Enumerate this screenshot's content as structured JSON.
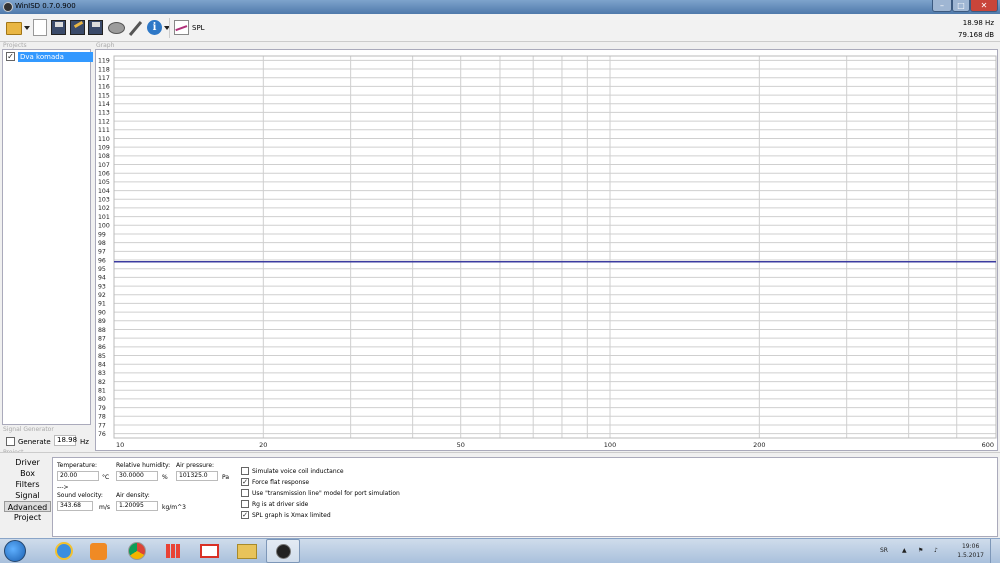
{
  "window": {
    "title": "WinISD 0.7.0.900",
    "minimize_label": "–",
    "maximize_label": "□",
    "close_label": "✕"
  },
  "toolbar": {
    "icons": [
      "open-folder-icon",
      "new-document-icon",
      "save-icon",
      "save-as-icon",
      "save-all-icon",
      "driver-icon",
      "tools-icon",
      "info-icon",
      "spl-graph-icon"
    ],
    "info_glyph": "i",
    "spl_label": "SPL"
  },
  "readout": {
    "frequency": "18.98 Hz",
    "level": "79.168 dB"
  },
  "sections": {
    "projects": "Projects",
    "graph": "Graph",
    "signal_generator": "Signal Generator",
    "project": "Project"
  },
  "projects": [
    {
      "name": "Dva komada",
      "checked": true,
      "check_glyph": "✓"
    }
  ],
  "signal_generator": {
    "generate_label": "Generate",
    "generate_checked": false,
    "frequency": "18.98",
    "unit": "Hz"
  },
  "chart_data": {
    "type": "line",
    "x_scale": "log",
    "xlim": [
      10,
      600
    ],
    "x_ticks": [
      10,
      20,
      50,
      100,
      200,
      600
    ],
    "x_gridlines": [
      10,
      20,
      30,
      40,
      50,
      60,
      70,
      80,
      90,
      100,
      200,
      300,
      400,
      500,
      600
    ],
    "ylim": [
      75.5,
      119.5
    ],
    "y_ticks": [
      76,
      77,
      78,
      79,
      80,
      81,
      82,
      83,
      84,
      85,
      86,
      87,
      88,
      89,
      90,
      91,
      92,
      93,
      94,
      95,
      96,
      97,
      98,
      99,
      100,
      101,
      102,
      103,
      104,
      105,
      106,
      107,
      108,
      109,
      110,
      111,
      112,
      113,
      114,
      115,
      116,
      117,
      118,
      119
    ],
    "grid": true,
    "series": [
      {
        "color": "#3c3ca0",
        "x": [
          10,
          600
        ],
        "y": [
          95.8,
          95.8
        ]
      }
    ]
  },
  "nav": {
    "items": [
      "Driver",
      "Box",
      "Filters",
      "Signal",
      "Advanced",
      "Project"
    ],
    "active": "Advanced"
  },
  "advanced": {
    "temperature": {
      "label": "Temperature:",
      "value": "20.00",
      "unit": "°C"
    },
    "humidity": {
      "label": "Relative humidity:",
      "value": "30.0000",
      "unit": "%"
    },
    "pressure": {
      "label": "Air pressure:",
      "value": "101325.0",
      "unit": "Pa"
    },
    "arrow": "--->",
    "sound_velocity": {
      "label": "Sound velocity:",
      "value": "343.68",
      "unit": "m/s"
    },
    "air_density": {
      "label": "Air density:",
      "value": "1.20095",
      "unit": "kg/m^3"
    },
    "options": [
      {
        "label": "Simulate voice coil inductance",
        "checked": false
      },
      {
        "label": "Force flat response",
        "checked": true
      },
      {
        "label": "Use \"transmission line\" model for port simulation",
        "checked": false
      },
      {
        "label": "Rg is at driver side",
        "checked": false
      },
      {
        "label": "SPL graph is Xmax limited",
        "checked": true
      }
    ],
    "check_glyph": "✓"
  },
  "taskbar": {
    "apps": [
      "start-icon",
      "internet-explorer-icon",
      "media-player-icon",
      "chrome-icon",
      "apps-grid-icon",
      "gmail-icon",
      "file-explorer-icon",
      "winisd-icon"
    ],
    "language": "SR",
    "tray_up": "▲",
    "time": "19:06",
    "date": "1.5.2017"
  }
}
